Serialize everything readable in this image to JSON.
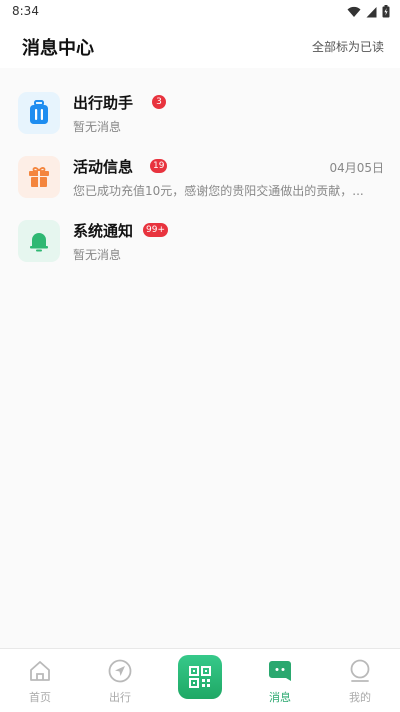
{
  "status_bar": {
    "time": "8:34"
  },
  "header": {
    "title": "消息中心",
    "mark_all_read": "全部标为已读"
  },
  "messages": [
    {
      "title": "出行助手",
      "badge": "3",
      "subtitle": "暂无消息",
      "date": "",
      "icon": "luggage-icon",
      "icon_color": "#1e8df0",
      "icon_bg": "#e7f4fd"
    },
    {
      "title": "活动信息",
      "badge": "19",
      "subtitle": "您已成功充值10元，感谢您的贵阳交通做出的贡献，...",
      "date": "04月05日",
      "icon": "gift-icon",
      "icon_color": "#f4853d",
      "icon_bg": "#fdeee6"
    },
    {
      "title": "系统通知",
      "badge": "99+",
      "subtitle": "暂无消息",
      "date": "",
      "icon": "bell-icon",
      "icon_color": "#2fb873",
      "icon_bg": "#e6f6ef"
    }
  ],
  "tabbar": {
    "home": "首页",
    "travel": "出行",
    "messages": "消息",
    "mine": "我的",
    "active_color": "#2aa86f",
    "inactive_color": "#aaaaaa"
  }
}
